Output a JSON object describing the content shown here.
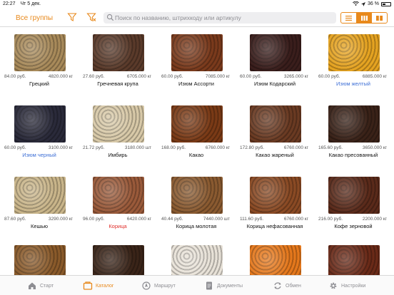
{
  "status_bar": {
    "time": "22:27",
    "date": "Чт 5 дек.",
    "battery": "36 %"
  },
  "toolbar": {
    "groups_label": "Все группы",
    "search_placeholder": "Поиск по названию, штрихкоду или артикулу",
    "view_modes": [
      "list",
      "grid-3",
      "grid-2"
    ],
    "active_view_mode": "grid-3"
  },
  "colors": {
    "accent": "#e8891c",
    "link_blue": "#3d6fd6",
    "alert_red": "#e0302c"
  },
  "products": [
    {
      "name": "Грецкий",
      "price": "84.00 руб.",
      "stock": "4820.000 кг",
      "style": "",
      "swatch": "#a88a5a"
    },
    {
      "name": "Гречневая крупа",
      "price": "27.60 руб.",
      "stock": "6705.000 кг",
      "style": "",
      "swatch": "#5a3a2a"
    },
    {
      "name": "Изюм Ассорти",
      "price": "60.00 руб.",
      "stock": "7085.000 кг",
      "style": "",
      "swatch": "#7a3a1c"
    },
    {
      "name": "Изюм Кодарский",
      "price": "60.00 руб.",
      "stock": "3265.000 кг",
      "style": "",
      "swatch": "#3a1e1c"
    },
    {
      "name": "Изюм желтый",
      "price": "60.00 руб.",
      "stock": "6885.000 кг",
      "style": "blue",
      "swatch": "#e5a321"
    },
    {
      "name": "Изюм черный",
      "price": "60.00 руб.",
      "stock": "3100.000 кг",
      "style": "blue",
      "swatch": "#2a2a3a"
    },
    {
      "name": "Имбирь",
      "price": "21.72 руб.",
      "stock": "3180.000 шт",
      "style": "",
      "swatch": "#d8c9a8"
    },
    {
      "name": "Какао",
      "price": "168.00 руб.",
      "stock": "6760.000 кг",
      "style": "",
      "swatch": "#7a3a16"
    },
    {
      "name": "Какао жареный",
      "price": "172.80 руб.",
      "stock": "6760.000 кг",
      "style": "",
      "swatch": "#6a3a22"
    },
    {
      "name": "Какао пресованный",
      "price": "165.60 руб.",
      "stock": "3650.000 кг",
      "style": "",
      "swatch": "#3a2218"
    },
    {
      "name": "Кешью",
      "price": "87.60 руб.",
      "stock": "3290.000 кг",
      "style": "",
      "swatch": "#c9b58a"
    },
    {
      "name": "Корица",
      "price": "96.00 руб.",
      "stock": "6420.000 кг",
      "style": "red",
      "swatch": "#9a5a3a"
    },
    {
      "name": "Корица молотая",
      "price": "40.44 руб.",
      "stock": "7440.000 шт",
      "style": "",
      "swatch": "#8a5a30"
    },
    {
      "name": "Корица нефасованная",
      "price": "111.60 руб.",
      "stock": "6760.000 кг",
      "style": "",
      "swatch": "#8a4a24"
    },
    {
      "name": "Кофе зерновой",
      "price": "216.00 руб.",
      "stock": "2200.000 кг",
      "style": "",
      "swatch": "#5a2a1a"
    },
    {
      "name": "",
      "price": "",
      "stock": "",
      "style": "",
      "swatch": "#8a5a2a"
    },
    {
      "name": "",
      "price": "",
      "stock": "",
      "style": "",
      "swatch": "#3a2418"
    },
    {
      "name": "",
      "price": "",
      "stock": "",
      "style": "",
      "swatch": "#e8e2d8"
    },
    {
      "name": "",
      "price": "",
      "stock": "",
      "style": "",
      "swatch": "#e5781c"
    },
    {
      "name": "",
      "price": "",
      "stock": "",
      "style": "",
      "swatch": "#6a2a18"
    }
  ],
  "tabs": [
    {
      "label": "Старт",
      "icon": "home-icon"
    },
    {
      "label": "Каталог",
      "icon": "catalog-icon"
    },
    {
      "label": "Маршрут",
      "icon": "route-icon"
    },
    {
      "label": "Документы",
      "icon": "documents-icon"
    },
    {
      "label": "Обмен",
      "icon": "sync-icon"
    },
    {
      "label": "Настройки",
      "icon": "gear-icon"
    }
  ],
  "active_tab": "Каталог"
}
